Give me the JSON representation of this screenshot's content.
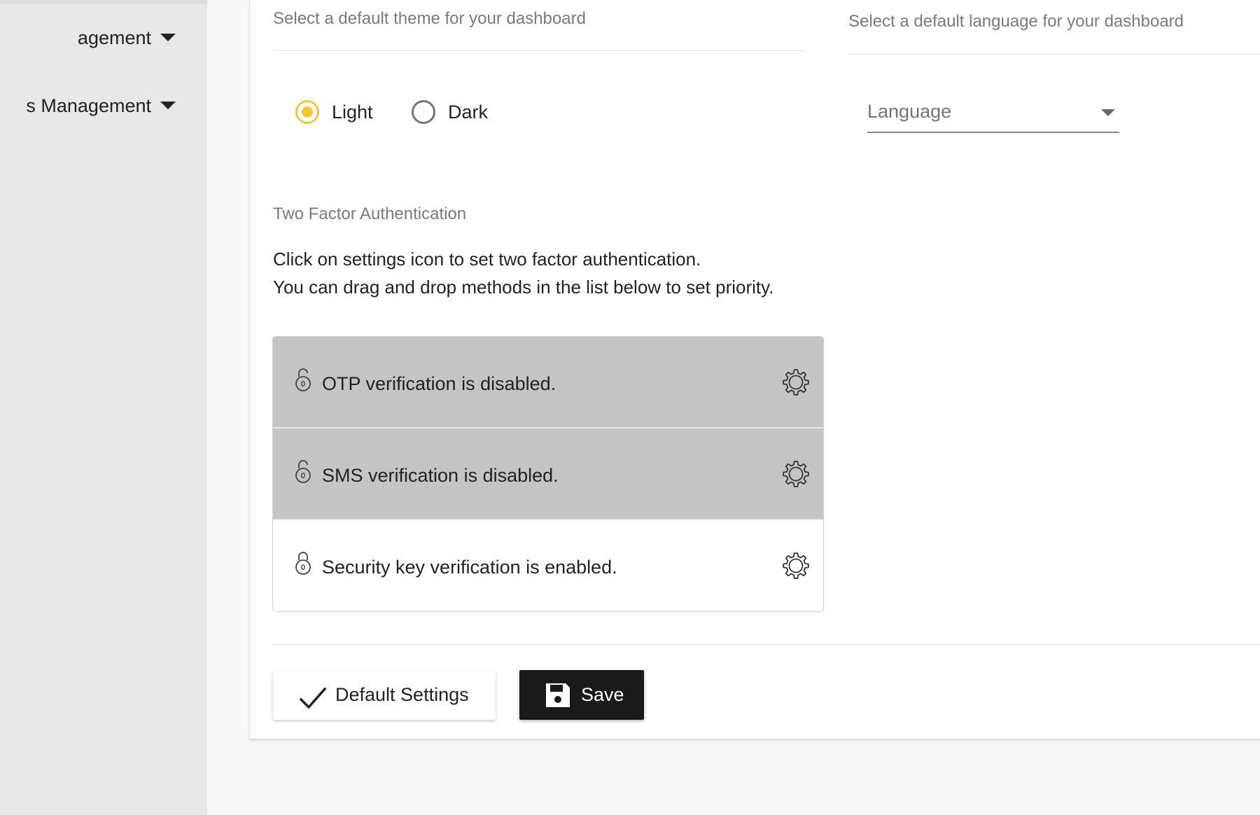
{
  "sidebar": {
    "items": [
      {
        "label": "agement",
        "icon": "chevron-down-icon"
      },
      {
        "label": "s Management",
        "icon": "chevron-down-icon"
      }
    ]
  },
  "settings": {
    "theme_caption": "Select a default theme for your dashboard",
    "language_caption": "Select a default language for your dashboard",
    "theme_options": [
      {
        "label": "Light",
        "checked": true
      },
      {
        "label": "Dark",
        "checked": false
      }
    ],
    "language_select": {
      "placeholder": "Language"
    },
    "two_factor": {
      "title": "Two Factor Authentication",
      "description_line1": "Click on settings icon to set two factor authentication.",
      "description_line2": "You can drag and drop methods in the list below to set priority.",
      "methods": [
        {
          "label": "OTP verification is disabled.",
          "enabled": false,
          "icon": "lock-icon",
          "action_icon": "gear-icon"
        },
        {
          "label": "SMS verification is disabled.",
          "enabled": false,
          "icon": "lock-icon",
          "action_icon": "gear-icon"
        },
        {
          "label": "Security key verification is enabled.",
          "enabled": true,
          "icon": "lock-icon",
          "action_icon": "gear-icon"
        }
      ]
    },
    "actions": {
      "default_label": "Default Settings",
      "save_label": "Save",
      "default_icon": "check-icon",
      "save_icon": "floppy-disk-icon"
    }
  },
  "colors": {
    "accent": "#f5c632",
    "disabled_row": "#c4c4c4",
    "save_button": "#1a1a1a"
  }
}
